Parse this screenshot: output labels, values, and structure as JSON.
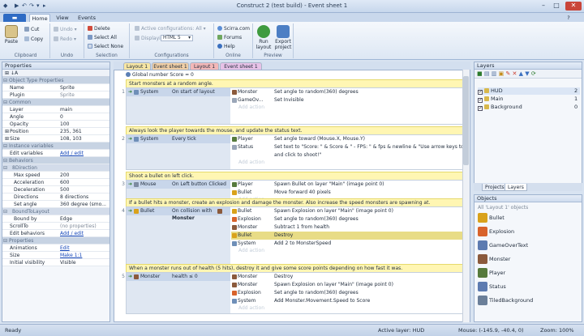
{
  "app": {
    "title": "Construct 2 (test build) - Event sheet 1",
    "quick_access": [
      "▶",
      "↶",
      "↷",
      "▾",
      "▸"
    ]
  },
  "ribbon": {
    "file_label": "",
    "tabs": [
      "Home",
      "View",
      "Events"
    ],
    "groups": {
      "clipboard": {
        "label": "Clipboard",
        "paste": "Paste",
        "cut": "Cut",
        "copy": "Copy"
      },
      "undo": {
        "label": "Undo",
        "undo": "Undo",
        "redo": "Redo"
      },
      "selection": {
        "label": "Selection",
        "delete": "Delete",
        "select_all": "Select All",
        "select_none": "Select None"
      },
      "configurations": {
        "label": "Configurations",
        "active": "Active configurations: All",
        "displaying_label": "Displaying:",
        "displaying_value": "HTML 5"
      },
      "online": {
        "label": "Online",
        "scirra": "Scirra.com",
        "forums": "Forums",
        "help": "Help"
      },
      "preview": {
        "label": "Preview",
        "run": "Run layout",
        "export": "Export project"
      }
    }
  },
  "properties": {
    "title": "Properties",
    "rows": [
      {
        "type": "sec",
        "k": "Object Type Properties"
      },
      {
        "k": "Name",
        "v": "Sprite"
      },
      {
        "k": "Plugin",
        "v": "Sprite",
        "style": "dis"
      },
      {
        "type": "sec",
        "k": "Common"
      },
      {
        "k": "Layer",
        "v": "main"
      },
      {
        "k": "Angle",
        "v": "0"
      },
      {
        "k": "Opacity",
        "v": "100"
      },
      {
        "k": "Position",
        "v": "235, 361",
        "exp": "+"
      },
      {
        "k": "Size",
        "v": "108, 103",
        "exp": "+"
      },
      {
        "type": "sec",
        "k": "Instance variables"
      },
      {
        "k": "Edit variables",
        "v": "Add / edit",
        "style": "link"
      },
      {
        "type": "sec",
        "k": "Behaviors"
      },
      {
        "type": "sec2",
        "k": "8Direction"
      },
      {
        "k": "Max speed",
        "v": "200",
        "sub": true
      },
      {
        "k": "Acceleration",
        "v": "600",
        "sub": true
      },
      {
        "k": "Deceleration",
        "v": "500",
        "sub": true
      },
      {
        "k": "Directions",
        "v": "8 directions",
        "sub": true
      },
      {
        "k": "Set angle",
        "v": "360 degree (smo...",
        "sub": true
      },
      {
        "type": "sec2",
        "k": "BoundToLayout"
      },
      {
        "k": "Bound by",
        "v": "Edge",
        "sub": true
      },
      {
        "k": "ScrollTo",
        "v": "(no properties)",
        "style": "dis"
      },
      {
        "k": "Edit behaviors",
        "v": "Add / edit",
        "style": "link"
      },
      {
        "type": "sec",
        "k": "Properties"
      },
      {
        "k": "Animations",
        "v": "Edit",
        "style": "link"
      },
      {
        "k": "Size",
        "v": "Make 1:1",
        "style": "link"
      },
      {
        "k": "Initial visibility",
        "v": "Visible"
      }
    ]
  },
  "editor_tabs": [
    "Layout 1",
    "Event sheet 1",
    "Layout 1",
    "Event sheet 1"
  ],
  "sheet": {
    "global": "Global number Score = 0",
    "add_action": "Add action",
    "comments": [
      "Start monsters at a random angle.",
      "Always look the player towards the mouse, and update the status text.",
      "Shoot a bullet on left click.",
      "If a bullet hits a monster, create an explosion and damage the monster.  Also increase the speed monsters are spawning at.",
      "When a monster runs out of health (5 hits), destroy it and give some score points depending on how fast it was."
    ],
    "events": [
      {
        "num": "1",
        "obj": "System",
        "cond": "On start of layout",
        "actions": [
          {
            "obj": "Monster",
            "txt": "Set angle to random(360)  degrees"
          },
          {
            "obj": "GameOv...",
            "txt": "Set Invisible"
          }
        ]
      },
      {
        "num": "2",
        "obj": "System",
        "cond": "Every tick",
        "actions": [
          {
            "obj": "Player",
            "txt": "Set angle toward (Mouse.X, Mouse.Y)"
          },
          {
            "obj": "Status",
            "txt": "Set text to \"Score: \" & Score & \" - FPS: \" & fps & newline & \"Use arrow keys to move"
          },
          {
            "obj": "",
            "txt": "and click to shoot!\""
          }
        ]
      },
      {
        "num": "3",
        "obj": "Mouse",
        "cond": "On Left button Clicked",
        "actions": [
          {
            "obj": "Player",
            "txt": "Spawn  Bullet on layer \"Main\" (image point 0)"
          },
          {
            "obj": "Bullet",
            "txt": "Move forward 40 pixels"
          }
        ]
      },
      {
        "num": "4",
        "obj": "Bullet",
        "cond": "On collision with",
        "cond2": "Monster",
        "actions": [
          {
            "obj": "Bullet",
            "txt": "Spawn  Explosion on layer \"Main\" (image point 0)"
          },
          {
            "obj": "Explosion",
            "txt": "Set angle to random(360)  degrees"
          },
          {
            "obj": "Monster",
            "txt": "Subtract 1 from health"
          },
          {
            "obj": "Bullet",
            "txt": "Destroy",
            "hl": true
          },
          {
            "obj": "System",
            "txt": "Add 2 to MonsterSpeed"
          }
        ]
      },
      {
        "num": "5",
        "obj": "Monster",
        "cond": "health ≤ 0",
        "actions": [
          {
            "obj": "Monster",
            "txt": "Destroy"
          },
          {
            "obj": "Monster",
            "txt": "Spawn  Explosion on layer \"Main\" (image point 0)"
          },
          {
            "obj": "Explosion",
            "txt": "Set angle to random(360)  degrees"
          },
          {
            "obj": "System",
            "txt": "Add Monster.Movement.Speed to Score"
          }
        ]
      }
    ]
  },
  "layers": {
    "title": "Layers",
    "items": [
      {
        "name": "HUD",
        "num": "2"
      },
      {
        "name": "Main",
        "num": "1"
      },
      {
        "name": "Background",
        "num": "0"
      }
    ],
    "tabs": [
      "Projects",
      "Layers"
    ]
  },
  "objects": {
    "title": "Objects",
    "header": "All 'Layout 1' objects",
    "items": [
      "Bullet",
      "Explosion",
      "GameOverText",
      "Monster",
      "Player",
      "Status",
      "TiledBackground"
    ]
  },
  "status": {
    "ready": "Ready",
    "active_layer": "Active layer: HUD",
    "mouse": "Mouse: (-145.9, -40.4, 0)",
    "zoom": "Zoom: 100%"
  },
  "colors": {
    "accent": "#2e6bc4",
    "comment_bg": "#fff6b3",
    "highlight": "#e8dc86"
  }
}
